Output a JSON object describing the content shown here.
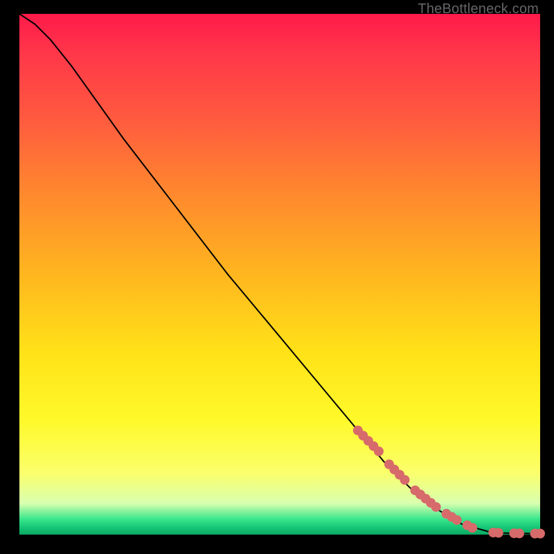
{
  "watermark": "TheBottleneck.com",
  "colors": {
    "line": "#000000",
    "marker": "#d76a6a",
    "background": "#000000"
  },
  "chart_data": {
    "type": "line",
    "title": "",
    "xlabel": "",
    "ylabel": "",
    "xlim": [
      0,
      100
    ],
    "ylim": [
      0,
      100
    ],
    "grid": false,
    "legend": false,
    "series": [
      {
        "name": "curve",
        "x": [
          0,
          3,
          6,
          10,
          15,
          20,
          30,
          40,
          50,
          60,
          65,
          70,
          75,
          80,
          85,
          90,
          91,
          93,
          95,
          97,
          99,
          100
        ],
        "y": [
          100,
          98,
          95,
          90,
          83,
          76,
          63,
          50,
          38,
          26,
          20,
          14,
          9,
          5,
          2,
          0.6,
          0.4,
          0.3,
          0.25,
          0.22,
          0.2,
          0.2
        ]
      }
    ],
    "markers": [
      {
        "x": 65,
        "y": 20
      },
      {
        "x": 66,
        "y": 19
      },
      {
        "x": 67,
        "y": 18
      },
      {
        "x": 68,
        "y": 17
      },
      {
        "x": 69,
        "y": 16
      },
      {
        "x": 71,
        "y": 13.5
      },
      {
        "x": 72,
        "y": 12.5
      },
      {
        "x": 73,
        "y": 11.5
      },
      {
        "x": 74,
        "y": 10.5
      },
      {
        "x": 76,
        "y": 8.5
      },
      {
        "x": 77,
        "y": 7.7
      },
      {
        "x": 78,
        "y": 6.9
      },
      {
        "x": 79,
        "y": 6.1
      },
      {
        "x": 80,
        "y": 5.3
      },
      {
        "x": 82,
        "y": 4.0
      },
      {
        "x": 83,
        "y": 3.4
      },
      {
        "x": 84,
        "y": 2.8
      },
      {
        "x": 86,
        "y": 1.8
      },
      {
        "x": 87,
        "y": 1.3
      },
      {
        "x": 91,
        "y": 0.4
      },
      {
        "x": 92,
        "y": 0.35
      },
      {
        "x": 95,
        "y": 0.25
      },
      {
        "x": 96,
        "y": 0.22
      },
      {
        "x": 99,
        "y": 0.2
      },
      {
        "x": 100,
        "y": 0.2
      }
    ]
  }
}
